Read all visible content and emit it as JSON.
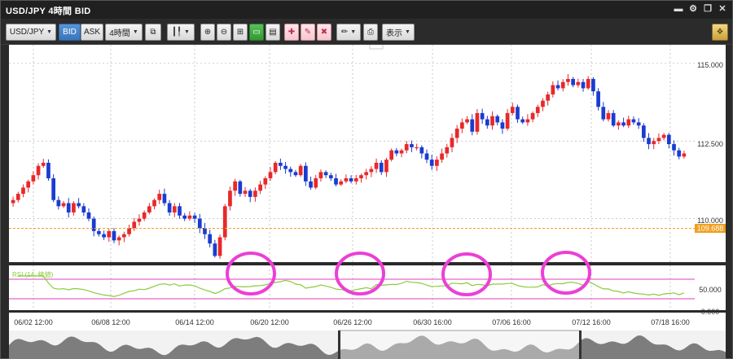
{
  "window": {
    "title": "USD/JPY 4時間 BID"
  },
  "toolbar": {
    "symbol": "USD/JPY",
    "bid_label": "BID",
    "ask_label": "ASK",
    "timeframe": "4時間",
    "display_label": "表示"
  },
  "price_axis": {
    "labels": [
      "115.000",
      "112.500",
      "110.000"
    ],
    "current_price": "109.688"
  },
  "rsi": {
    "label": "RSI (14, 終値)",
    "axis_label": "50.000",
    "axis_label_cut": "0.000"
  },
  "time_axis": {
    "labels": [
      "06/02 12:00",
      "06/08 12:00",
      "06/14 12:00",
      "06/20 12:00",
      "06/26 12:00",
      "06/30 16:00",
      "07/06 16:00",
      "07/12 16:00",
      "07/18 16:00"
    ]
  },
  "colors": {
    "up": "#e8282a",
    "down": "#1a3cd0",
    "rsi_line": "#8acc3c",
    "rsi_band": "#e040c0",
    "highlight_circle": "#ec3fd6",
    "price_marker": "#f0a020"
  },
  "chart_data": {
    "type": "candlestick",
    "y_range": [
      108.6,
      115.6
    ],
    "gridlines": true,
    "rsi_levels": [
      30,
      70
    ],
    "closes": [
      110.6,
      110.8,
      111.0,
      111.2,
      111.4,
      111.7,
      111.8,
      111.3,
      110.6,
      110.4,
      110.5,
      110.2,
      110.5,
      110.4,
      110.2,
      110.0,
      109.6,
      109.5,
      109.4,
      109.6,
      109.3,
      109.4,
      109.5,
      109.7,
      109.9,
      110.0,
      110.2,
      110.4,
      110.6,
      110.8,
      110.5,
      110.2,
      110.4,
      110.1,
      110.0,
      110.1,
      110.0,
      109.7,
      109.5,
      109.2,
      108.8,
      109.4,
      110.4,
      110.9,
      111.2,
      110.8,
      110.9,
      110.7,
      110.9,
      111.1,
      111.3,
      111.5,
      111.8,
      111.7,
      111.6,
      111.5,
      111.4,
      111.7,
      111.2,
      111.0,
      111.3,
      111.5,
      111.4,
      111.3,
      111.1,
      111.2,
      111.3,
      111.2,
      111.3,
      111.4,
      111.5,
      111.6,
      111.8,
      111.5,
      111.9,
      112.2,
      112.1,
      112.2,
      112.4,
      112.3,
      112.3,
      112.1,
      111.9,
      111.7,
      111.9,
      112.1,
      112.3,
      112.6,
      112.9,
      113.1,
      113.2,
      112.8,
      113.4,
      113.2,
      113.0,
      113.3,
      113.1,
      112.9,
      113.4,
      113.6,
      113.2,
      113.1,
      113.2,
      113.4,
      113.6,
      113.8,
      114.0,
      114.3,
      114.2,
      114.4,
      114.5,
      114.3,
      114.4,
      114.2,
      114.5,
      114.1,
      113.6,
      113.2,
      113.4,
      113.0,
      113.1,
      113.0,
      113.2,
      113.1,
      113.0,
      112.6,
      112.4,
      112.5,
      112.6,
      112.7,
      112.4,
      112.2,
      112.0,
      112.1
    ]
  }
}
